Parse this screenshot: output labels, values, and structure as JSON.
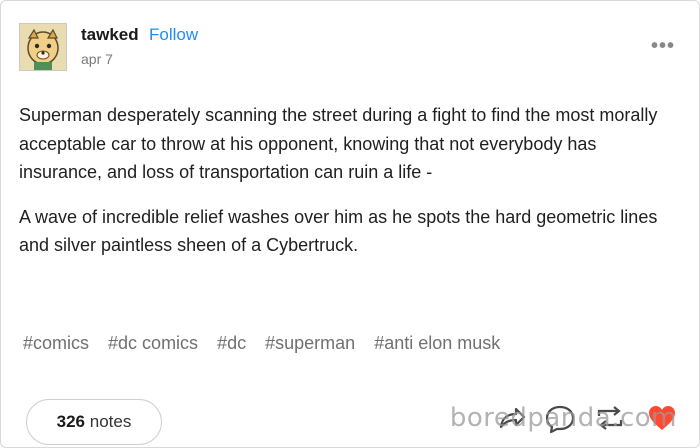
{
  "post": {
    "username": "tawked",
    "follow_label": "Follow",
    "date": "apr 7",
    "body": [
      "Superman desperately scanning the street during a fight to find the most morally acceptable car to throw at his opponent, knowing that not everybody has insurance, and loss of transportation can ruin a life -",
      "A wave of incredible relief washes over him as he spots the hard geometric lines and silver paintless sheen of a Cybertruck."
    ],
    "tags": [
      "#comics",
      "#dc comics",
      "#dc",
      "#superman",
      "#anti elon musk"
    ]
  },
  "footer": {
    "notes_count": "326",
    "notes_label": "notes",
    "actions": [
      "share-icon",
      "reply-icon",
      "reblog-icon",
      "like-icon"
    ]
  },
  "watermark": "boredpanda.com",
  "colors": {
    "accent": "#1d8df5",
    "like": "#ff4930",
    "tag": "#707070"
  }
}
